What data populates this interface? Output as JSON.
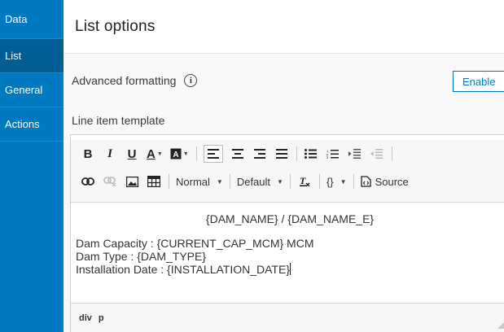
{
  "sidebar": {
    "items": [
      {
        "label": "Data"
      },
      {
        "label": "List"
      },
      {
        "label": "General"
      },
      {
        "label": "Actions"
      }
    ],
    "active": "List",
    "color": "#0079c1"
  },
  "header": {
    "title": "List options"
  },
  "advanced": {
    "label": "Advanced formatting",
    "info_icon": "info-icon",
    "enable_label": "Enable"
  },
  "template": {
    "label": "Line item template",
    "toolbar": {
      "bold": "B",
      "italic": "I",
      "underline": "U",
      "font_color": "A",
      "format_dropdown": "Normal",
      "font_dropdown": "Default",
      "braces": "{}",
      "source_label": "Source"
    },
    "content": {
      "heading": "{DAM_NAME} / {DAM_NAME_E}",
      "lines": [
        "Dam Capacity : {CURRENT_CAP_MCM} MCM",
        "Dam Type : {DAM_TYPE}",
        "Installation Date : {INSTALLATION_DATE}"
      ]
    },
    "status_path": [
      "div",
      "p"
    ]
  }
}
